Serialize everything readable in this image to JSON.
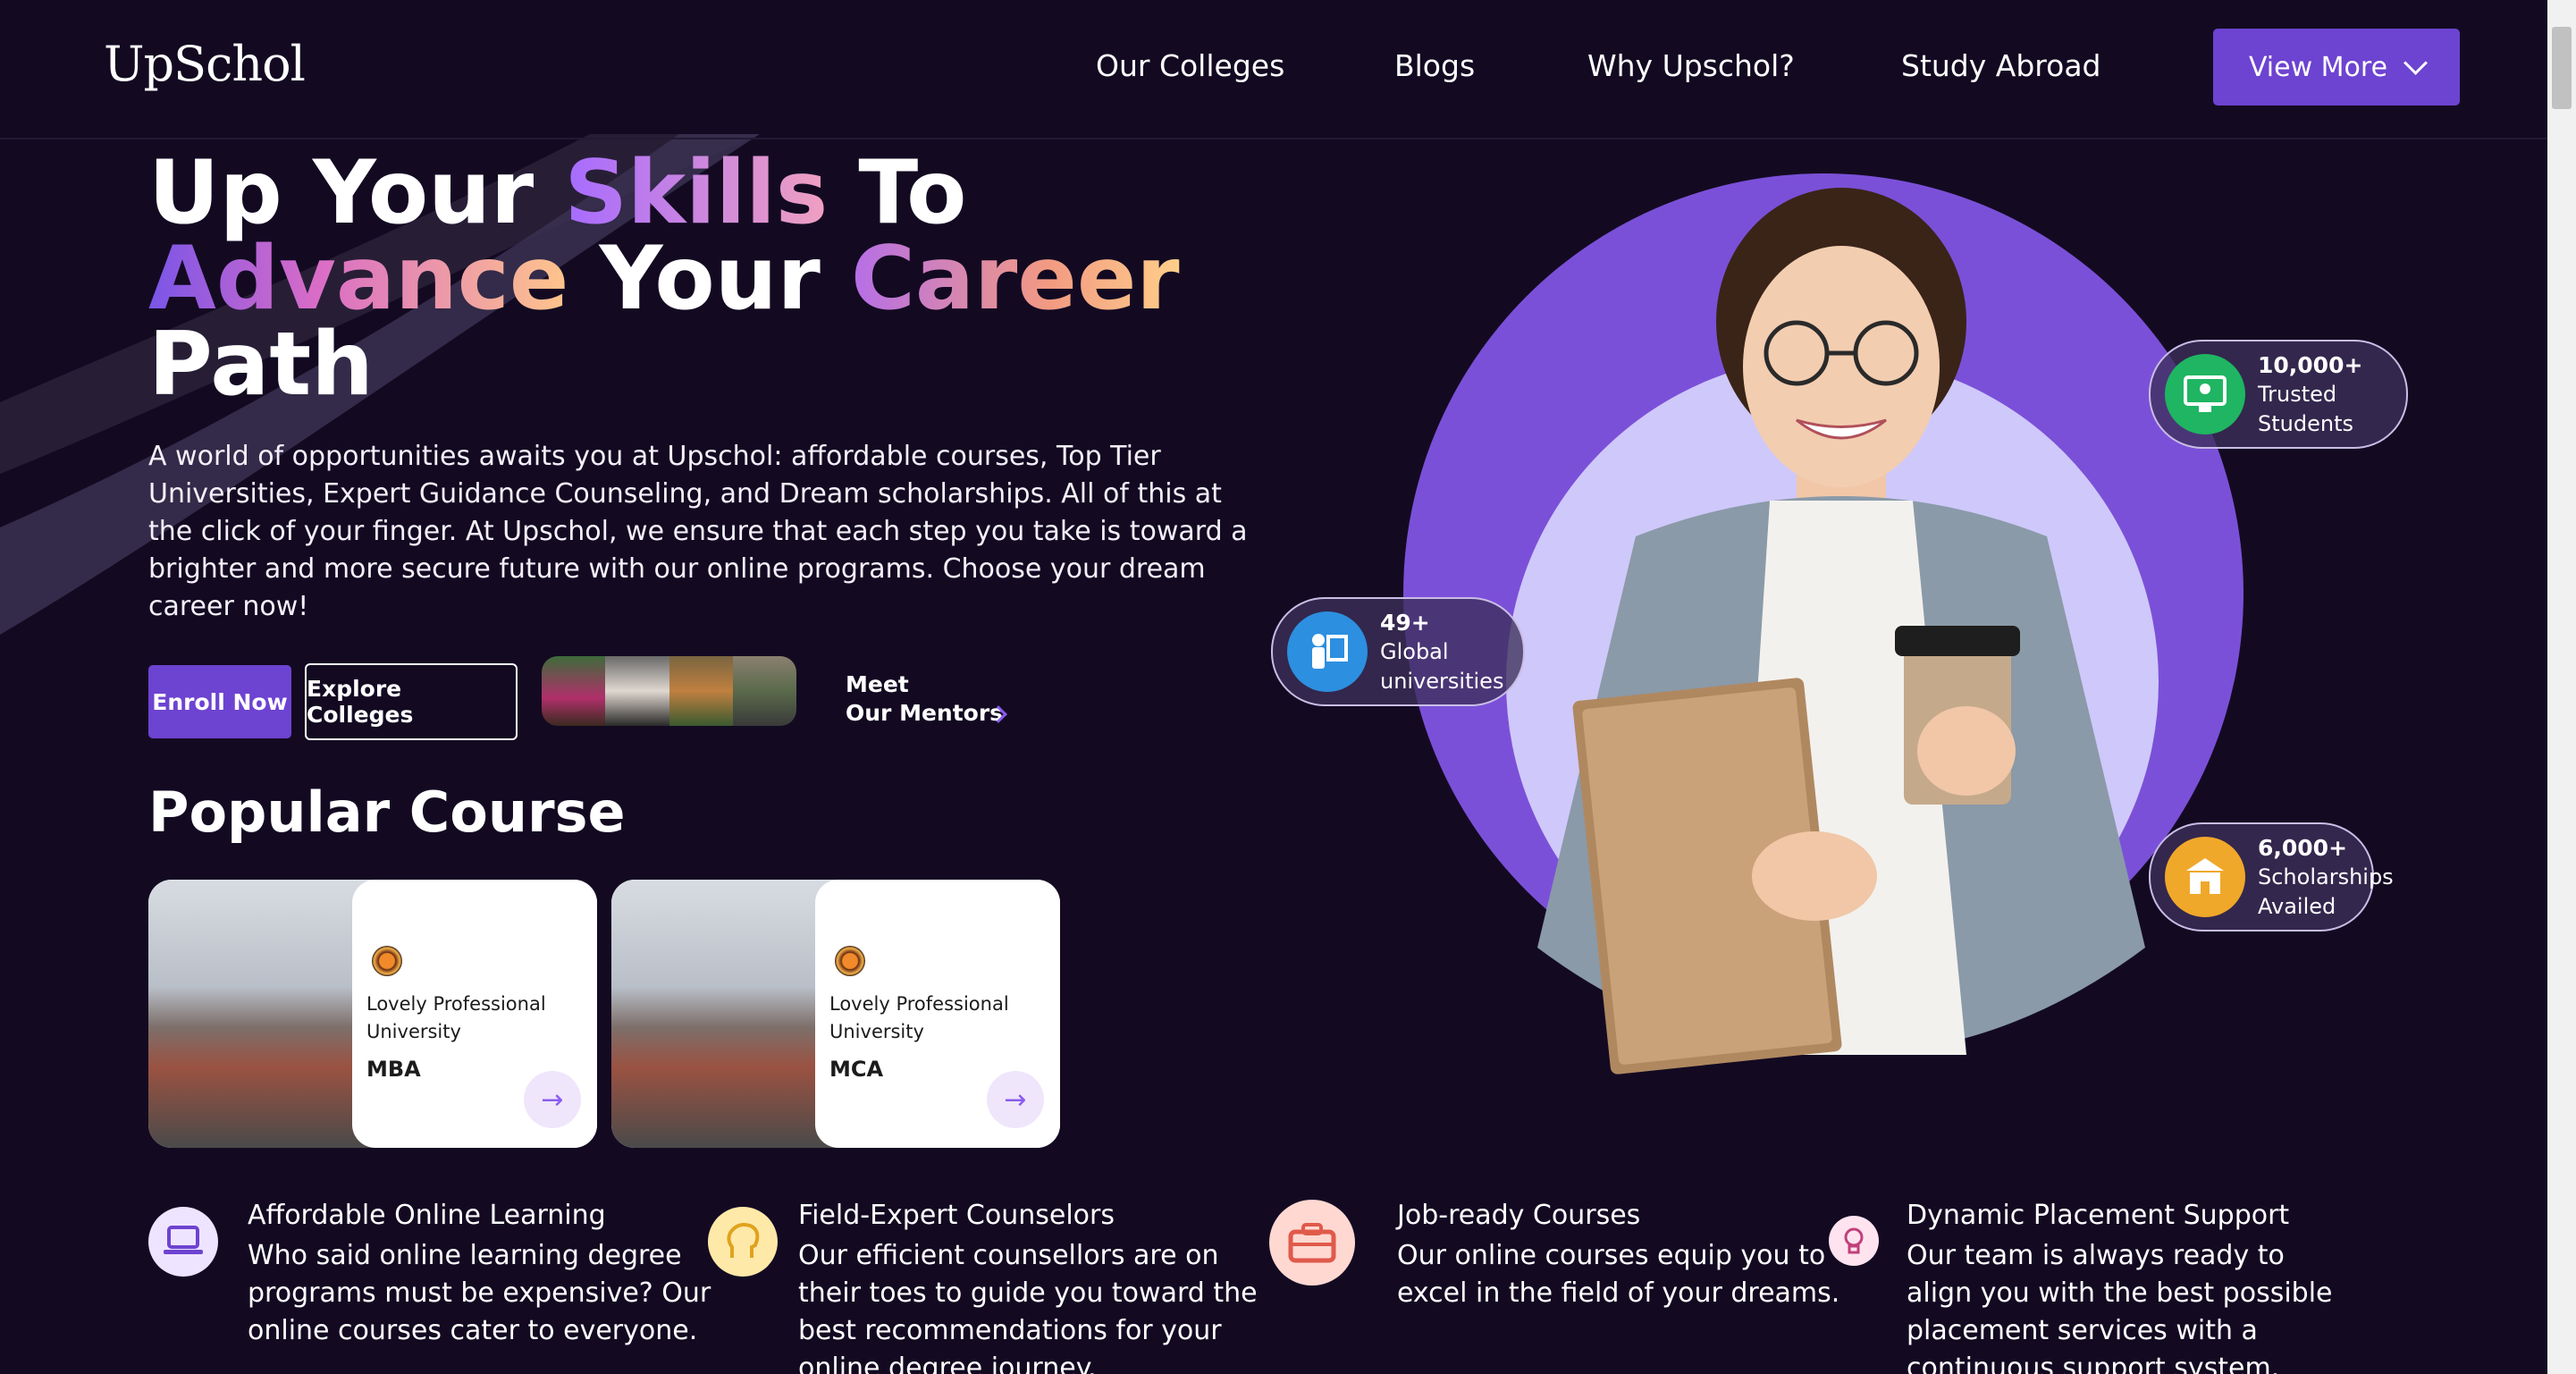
{
  "header": {
    "logo": "UpSchol",
    "nav": [
      "Our Colleges",
      "Blogs",
      "Why Upschol?",
      "Study Abroad"
    ],
    "view_more": "View More"
  },
  "hero": {
    "line1_a": "Up Your ",
    "line1_b": "Skills",
    "line1_c": " To",
    "line2_a": "Advance",
    "line2_b": " Your ",
    "line2_c": "Career",
    "line3": "Path",
    "description": "A world of opportunities awaits you at Upschol: affordable courses, Top Tier Universities, Expert Guidance Counseling, and Dream scholarships. All of this at the click of your finger. At Upschol, we ensure that each step you take is toward a brighter and more secure future with our online programs. Choose your dream career now!",
    "enroll_label": "Enroll Now",
    "explore_label": "Explore Colleges",
    "meet_line1": "Meet",
    "meet_line2": "Our Mentors"
  },
  "popular": {
    "heading": "Popular Course",
    "cards": [
      {
        "university": "Lovely Professional University",
        "course": "MBA"
      },
      {
        "university": "Lovely Professional University",
        "course": "MCA"
      }
    ]
  },
  "stats": [
    {
      "value": "10,000+",
      "line1": "Trusted",
      "line2": "Students",
      "color": "#1fb562"
    },
    {
      "value": "49+",
      "line1": "Global",
      "line2": "universities",
      "color": "#2c8fe0"
    },
    {
      "value": "6,000+",
      "line1": "Scholarships",
      "line2": "Availed",
      "color": "#f0a82a"
    }
  ],
  "features": [
    {
      "title": "Affordable Online Learning",
      "desc": "Who said online learning degree programs must be expensive? Our online courses cater to everyone.",
      "icon": "laptop-icon",
      "color": "#eee4ff"
    },
    {
      "title": "Field-Expert Counselors",
      "desc": "Our efficient counsellors are on their toes to guide you toward the best recommendations for your online degree journey.",
      "icon": "head-icon",
      "color": "#ffe9a8"
    },
    {
      "title": "Job-ready Courses",
      "desc": "Our online courses equip you to excel in the field of your dreams.",
      "icon": "briefcase-icon",
      "color": "#ffd8d1"
    },
    {
      "title": "Dynamic Placement Support",
      "desc": "Our team is always ready to align you with the best possible placement services with a continuous support system.",
      "icon": "bulb-icon",
      "color": "#ffe3ef"
    }
  ],
  "colors": {
    "accent": "#6d43d1",
    "background": "#130a22"
  }
}
